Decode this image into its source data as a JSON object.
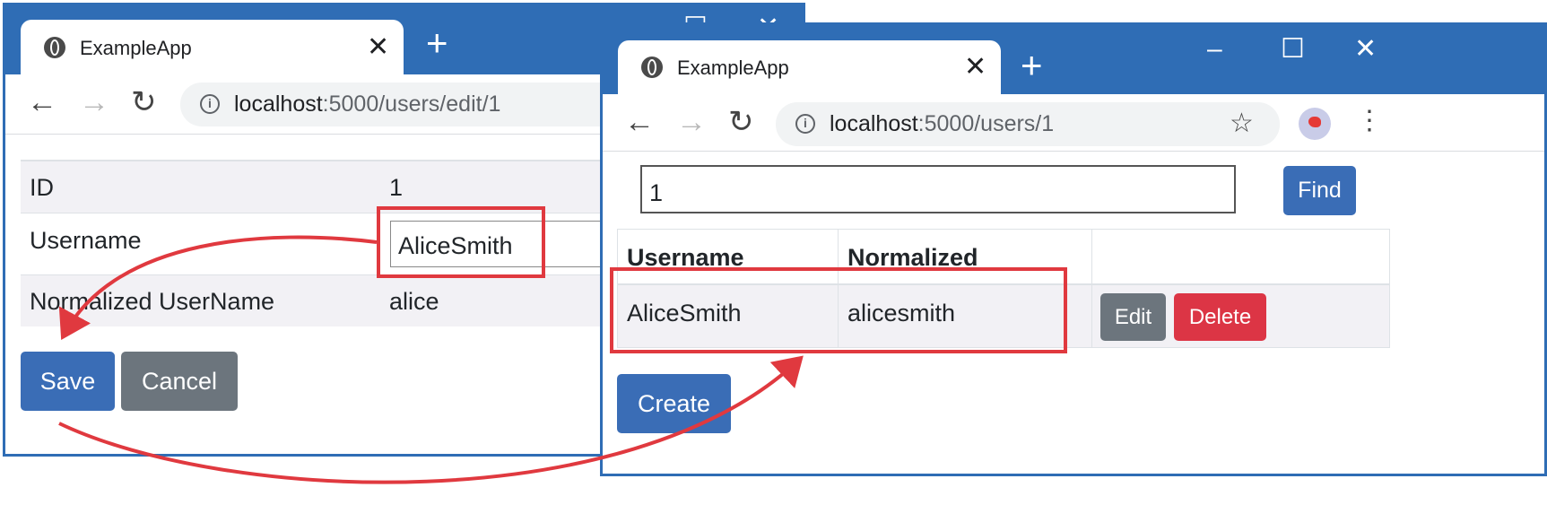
{
  "left_window": {
    "tab_title": "ExampleApp",
    "url_host": "localhost",
    "url_path": ":5000/users/edit/1",
    "rows": [
      {
        "label": "ID",
        "value": "1"
      },
      {
        "label": "Username",
        "value": "AliceSmith"
      },
      {
        "label": "Normalized UserName",
        "value": "alice"
      }
    ],
    "save_label": "Save",
    "cancel_label": "Cancel"
  },
  "right_window": {
    "tab_title": "ExampleApp",
    "url_host": "localhost",
    "url_path": ":5000/users/1",
    "search_value": "1",
    "find_label": "Find",
    "table": {
      "headers": [
        "Username",
        "Normalized",
        ""
      ],
      "rows": [
        {
          "username": "AliceSmith",
          "normalized": "alicesmith"
        }
      ]
    },
    "edit_label": "Edit",
    "delete_label": "Delete",
    "create_label": "Create"
  },
  "icons": {
    "close": "✕",
    "plus": "+",
    "back": "←",
    "forward": "→",
    "reload": "↻",
    "minimize": "–",
    "maximize": "☐",
    "star": "☆",
    "menu": "⋮"
  },
  "colors": {
    "accent": "#2f6db5",
    "primary": "#3a6db6",
    "secondary": "#6c757d",
    "danger": "#dc3545",
    "highlight": "#e0393f"
  }
}
